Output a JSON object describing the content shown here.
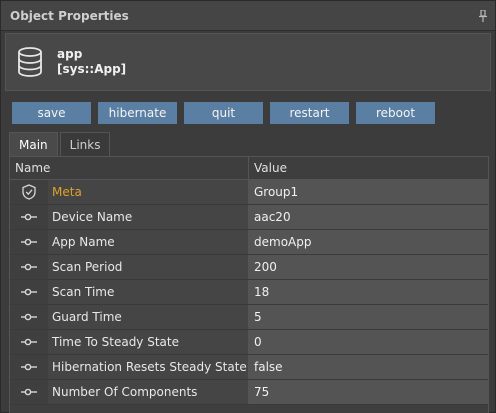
{
  "panel": {
    "title": "Object Properties"
  },
  "header": {
    "name": "app",
    "type": "[sys::App]"
  },
  "buttons": [
    {
      "label": "save"
    },
    {
      "label": "hibernate"
    },
    {
      "label": "quit"
    },
    {
      "label": "restart"
    },
    {
      "label": "reboot"
    }
  ],
  "tabs": [
    {
      "label": "Main",
      "active": true
    },
    {
      "label": "Links",
      "active": false
    }
  ],
  "grid": {
    "columns": {
      "name": "Name",
      "value": "Value"
    },
    "rows": [
      {
        "name": "Meta",
        "value": "Group1",
        "icon": "shield-icon"
      },
      {
        "name": "Device Name",
        "value": "aac20",
        "icon": "property-icon"
      },
      {
        "name": "App Name",
        "value": "demoApp",
        "icon": "property-icon"
      },
      {
        "name": "Scan Period",
        "value": "200",
        "icon": "property-icon"
      },
      {
        "name": "Scan Time",
        "value": "18",
        "icon": "property-icon"
      },
      {
        "name": "Guard Time",
        "value": "5",
        "icon": "property-icon"
      },
      {
        "name": "Time To Steady State",
        "value": "0",
        "icon": "property-icon"
      },
      {
        "name": "Hibernation Resets Steady State",
        "value": "false",
        "icon": "property-icon"
      },
      {
        "name": "Number Of Components",
        "value": "75",
        "icon": "property-icon"
      }
    ]
  },
  "colors": {
    "button": "#5b7fa3",
    "meta_label": "#e0a12a",
    "background": "#3a3a3a"
  }
}
